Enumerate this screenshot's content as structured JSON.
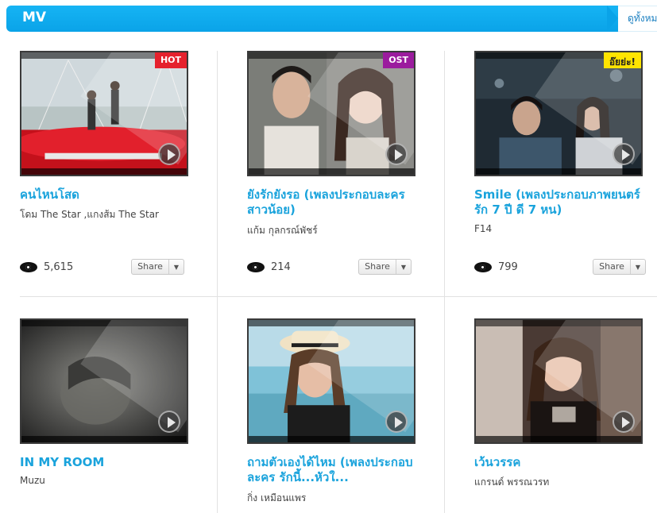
{
  "header": {
    "title": "MV",
    "see_all": "ดูทั้งหมด"
  },
  "colors": {
    "header_blue": "#0aa3e8",
    "title_blue": "#1aa3dc",
    "hot_red": "#e5212d",
    "ost_purple": "#9b1c9e",
    "oyae_yellow": "#ffe400"
  },
  "videos": [
    {
      "title": "คนไหนโสด",
      "artist": "โดม The Star ,แกงส้ม The Star",
      "views": "5,615",
      "badge": "HOT",
      "share_label": "Share",
      "icon": "play-icon"
    },
    {
      "title": "ยังรักยังรอ (เพลงประกอบละคร สาวน้อย)",
      "artist": "แก้ม กุลกรณ์พัชร์",
      "views": "214",
      "badge": "OST",
      "share_label": "Share",
      "icon": "play-icon"
    },
    {
      "title": "Smile (เพลงประกอบภาพยนตร์ รัก 7 ปี ดี 7 หน)",
      "artist": "F14",
      "views": "799",
      "badge": "อ๊ยย่ะ!",
      "share_label": "Share",
      "icon": "play-icon"
    },
    {
      "title": "IN MY ROOM",
      "artist": "Muzu",
      "icon": "play-icon"
    },
    {
      "title": "ถามตัวเองได้ไหม (เพลงประกอบละคร รักนี้...หัวใ...",
      "artist": "กิ่ง เหมือนแพร",
      "icon": "play-icon"
    },
    {
      "title": "เว้นวรรค",
      "artist": "แกรนด์ พรรณวรท",
      "icon": "play-icon"
    }
  ]
}
